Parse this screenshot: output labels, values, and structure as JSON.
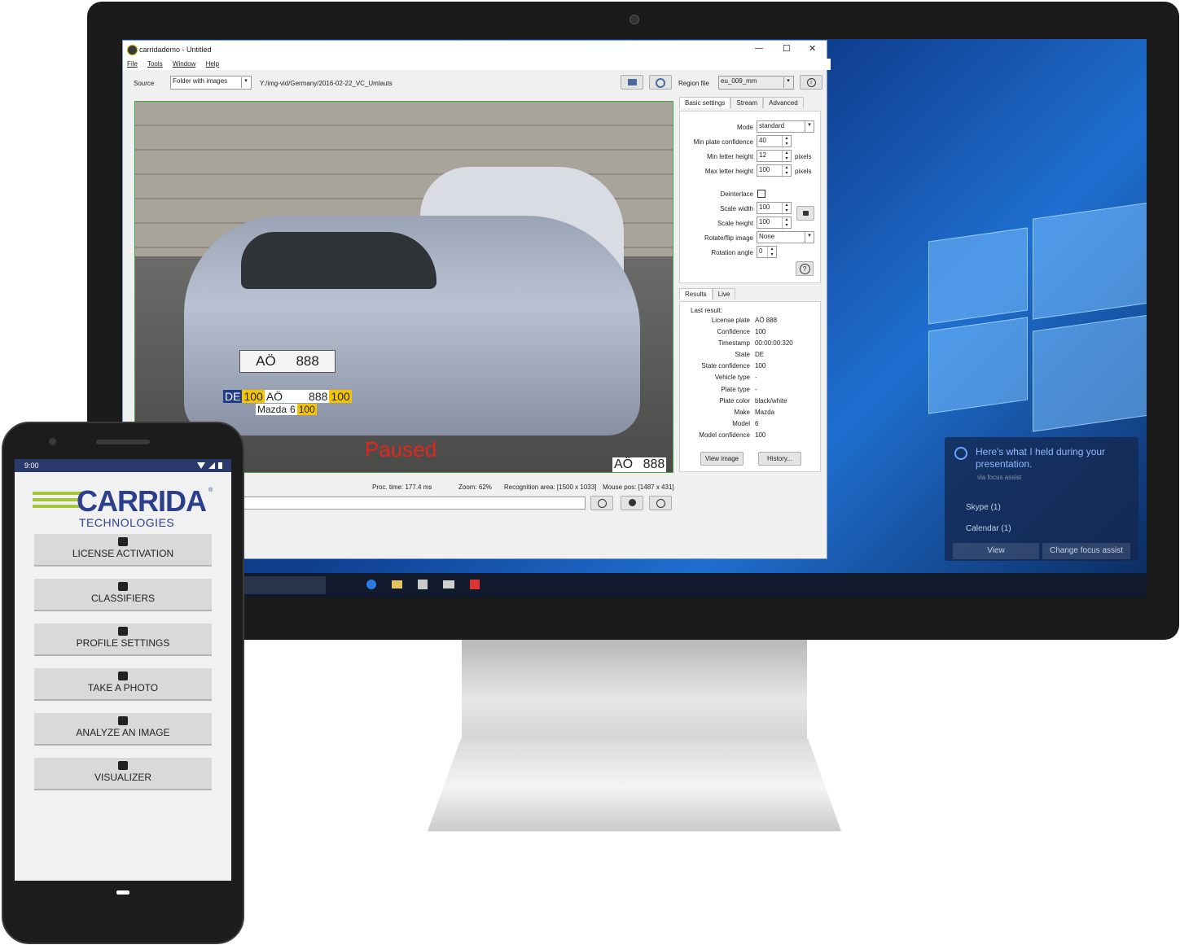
{
  "window": {
    "title": "carridademo - Untitled",
    "min": "—",
    "max": "☐",
    "close": "✕"
  },
  "menu": [
    "File",
    "Tools",
    "Window",
    "Help"
  ],
  "toolbar": {
    "source_label": "Source",
    "source_value": "Folder with images",
    "path": "Y:/img-vid/Germany/2016-02-22_VC_Umlauts",
    "region_label": "Region file",
    "region_value": "eu_009_mm"
  },
  "video": {
    "paused": "Paused",
    "plate_overlay_1": "DE",
    "plate_overlay_2": "100",
    "plate_overlay_3": "AÖ",
    "plate_overlay_4": "888",
    "plate_overlay_5": "100",
    "make_overlay_1": "Mazda",
    "make_overlay_2": "6",
    "make_overlay_3": "100",
    "bottom_plate_1": "AÖ",
    "bottom_plate_2": "888",
    "plate_on_car_1": "AÖ",
    "plate_on_car_2": "888"
  },
  "status": {
    "proc": "Proc. time: 177.4 ms",
    "zoom": "Zoom: 62%",
    "area": "Recognition area: [1500 x 1033]",
    "mouse": "Mouse pos: [1487 x 431]"
  },
  "settings": {
    "tabs": [
      "Basic settings",
      "Stream",
      "Advanced"
    ],
    "mode_label": "Mode",
    "mode_value": "standard",
    "minconf_label": "Min plate confidence",
    "minconf_value": "40",
    "minletter_label": "Min letter height",
    "minletter_value": "12",
    "pixels": "pixels",
    "maxletter_label": "Max letter height",
    "maxletter_value": "100",
    "deinterlace_label": "Deinterlace",
    "scalew_label": "Scale width",
    "scalew_value": "100",
    "scaleh_label": "Scale height",
    "scaleh_value": "100",
    "rotate_label": "Rotate/flip image",
    "rotate_value": "None",
    "angle_label": "Rotation angle",
    "angle_value": "0",
    "help": "?"
  },
  "results": {
    "tabs": [
      "Results",
      "Live"
    ],
    "last": "Last result:",
    "rows": [
      {
        "k": "License plate",
        "v": "AÖ 888"
      },
      {
        "k": "Confidence",
        "v": "100"
      },
      {
        "k": "Timestamp",
        "v": "00:00:00:320"
      },
      {
        "k": "State",
        "v": "DE"
      },
      {
        "k": "State confidence",
        "v": "100"
      },
      {
        "k": "Vehicle type",
        "v": "-"
      },
      {
        "k": "Plate type",
        "v": "-"
      },
      {
        "k": "Plate color",
        "v": "black/white"
      },
      {
        "k": "Make",
        "v": "Mazda"
      },
      {
        "k": "Model",
        "v": "6"
      },
      {
        "k": "Model confidence",
        "v": "100"
      }
    ],
    "view_image": "View image",
    "history": "History..."
  },
  "focus_assist": {
    "title": "Here's what I held during your presentation.",
    "sub": "via focus assist",
    "item1": "Skype (1)",
    "item2": "Calendar (1)",
    "btn_view": "View",
    "btn_change": "Change focus assist"
  },
  "phone": {
    "time": "9:00",
    "brand": "CARRIDA",
    "brand_sub": "TECHNOLOGIES",
    "reg": "®",
    "buttons": [
      "LICENSE ACTIVATION",
      "CLASSIFIERS",
      "PROFILE SETTINGS",
      "TAKE A PHOTO",
      "ANALYZE AN IMAGE",
      "VISUALIZER"
    ]
  },
  "colors": {
    "accent_yellow": "#f5c400",
    "brand_blue": "#2b3f8c",
    "brand_green": "#a8c43a",
    "overlay_red": "#e0261f"
  }
}
